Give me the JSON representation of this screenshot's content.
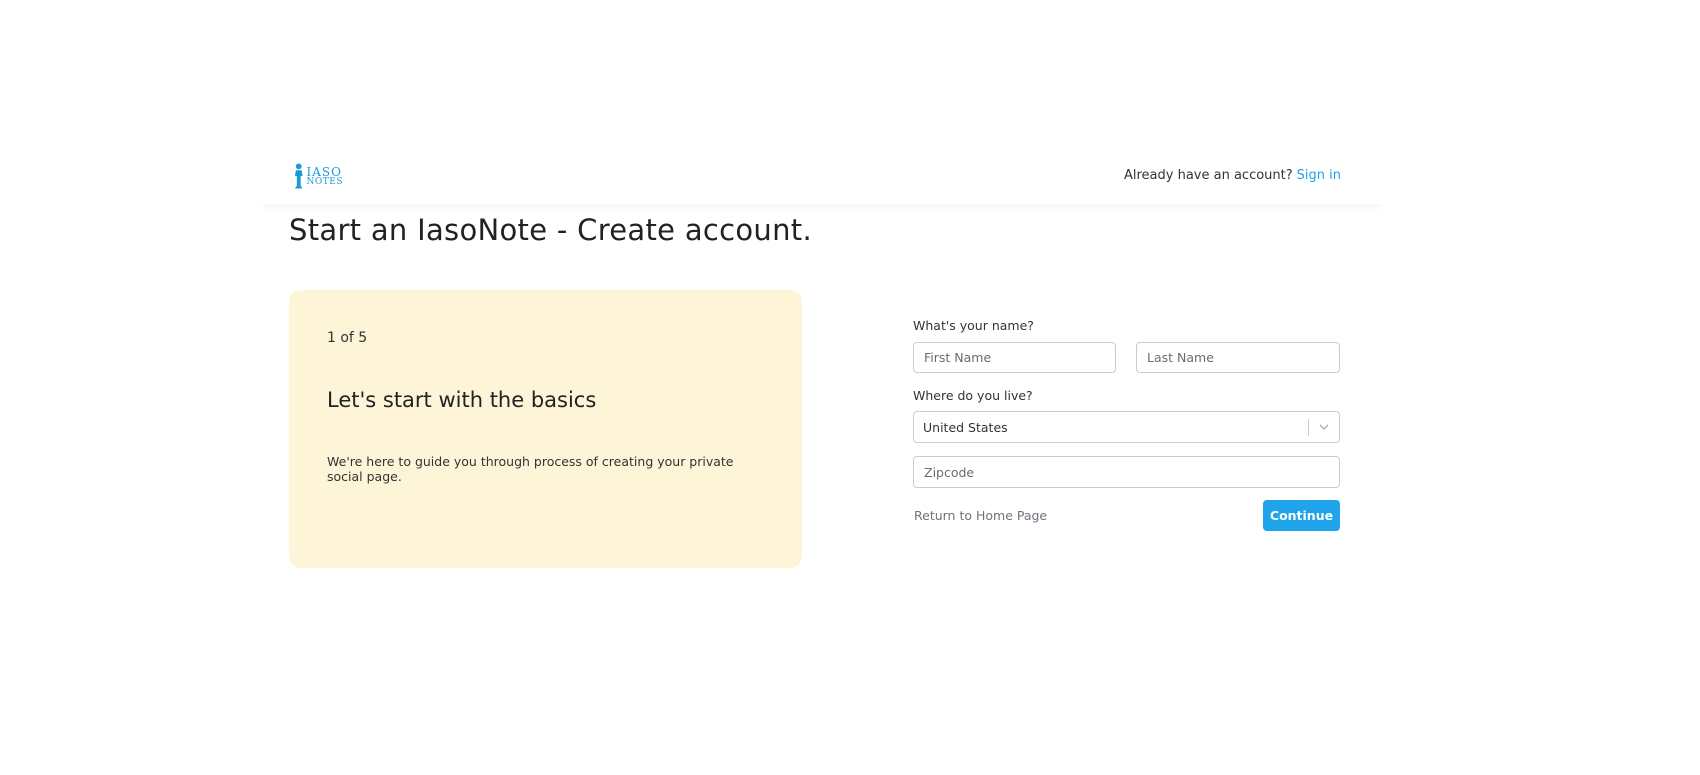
{
  "header": {
    "logo_line1": "IASO",
    "logo_line2": "NOTES",
    "account_prompt": "Already have an account?",
    "signin_label": "Sign in"
  },
  "page": {
    "title": "Start an IasoNote - Create account."
  },
  "info_card": {
    "step": "1 of 5",
    "heading": "Let's start with the basics",
    "description": "We're here to guide you through process of creating your private social page."
  },
  "form": {
    "name_label": "What's your name?",
    "first_name_placeholder": "First Name",
    "last_name_placeholder": "Last Name",
    "location_label": "Where do you live?",
    "country_value": "United States",
    "zipcode_placeholder": "Zipcode",
    "return_label": "Return to Home Page",
    "continue_label": "Continue"
  },
  "colors": {
    "accent": "#1fa3ea",
    "card_bg": "#fef4d7"
  }
}
